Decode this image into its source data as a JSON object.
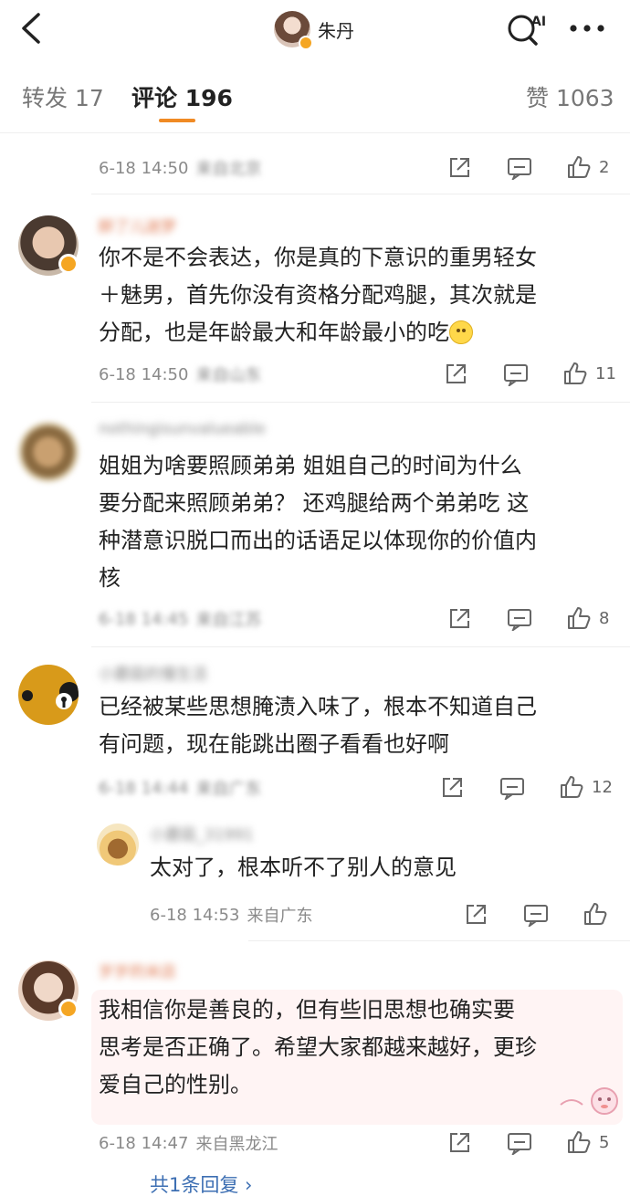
{
  "header": {
    "user_name": "朱丹",
    "ai_label": "AI"
  },
  "tabs": [
    {
      "label": "转发 17"
    },
    {
      "label": "评论 196"
    },
    {
      "label": "赞 1063"
    }
  ],
  "comments": [
    {
      "time": "6-18 14:50",
      "location": "来自北京",
      "likes": "2"
    },
    {
      "nickname": "醉了儿迷梦",
      "text_lines": [
        "你不是不会表达，你是真的下意识的重男轻女",
        "＋魅男，首先你没有资格分配鸡腿，其次就是",
        "分配，也是年龄最大和年龄最小的吃"
      ],
      "emoji": "slight-smile-emoji",
      "time": "6-18 14:50",
      "location": "来自山东",
      "likes": "11"
    },
    {
      "nickname": "nothingisunvalueable",
      "text_lines": [
        "姐姐为啥要照顾弟弟 姐姐自己的时间为什么",
        "要分配来照顾弟弟？  还鸡腿给两个弟弟吃 这",
        "种潜意识脱口而出的话语足以体现你的价值内",
        "核"
      ],
      "time": "6-18 14:45",
      "location": "来自江苏",
      "likes": "8"
    },
    {
      "nickname": "小蘑菇的慢生活",
      "text_lines": [
        "已经被某些思想腌渍入味了，根本不知道自己",
        "有问题，现在能跳出圈子看看也好啊"
      ],
      "time": "6-18 14:44",
      "location": "来自广东",
      "likes": "12",
      "reply": {
        "nickname": "小蘑菇_31991",
        "text": "太对了，根本听不了别人的意见",
        "time": "6-18 14:53",
        "location": "来自广东"
      }
    },
    {
      "nickname": "岁岁的米店",
      "text_lines": [
        "我相信你是善良的，但有些旧思想也确实要",
        "思考是否正确了。希望大家都越来越好，更珍",
        "爱自己的性别。"
      ],
      "time": "6-18 14:47",
      "location": "来自黑龙江",
      "likes": "5",
      "reply_link": "共1条回复 ›"
    }
  ],
  "colors": {
    "accent": "#f08a24",
    "link": "#3d6fb3",
    "badge": "#f5a623"
  }
}
